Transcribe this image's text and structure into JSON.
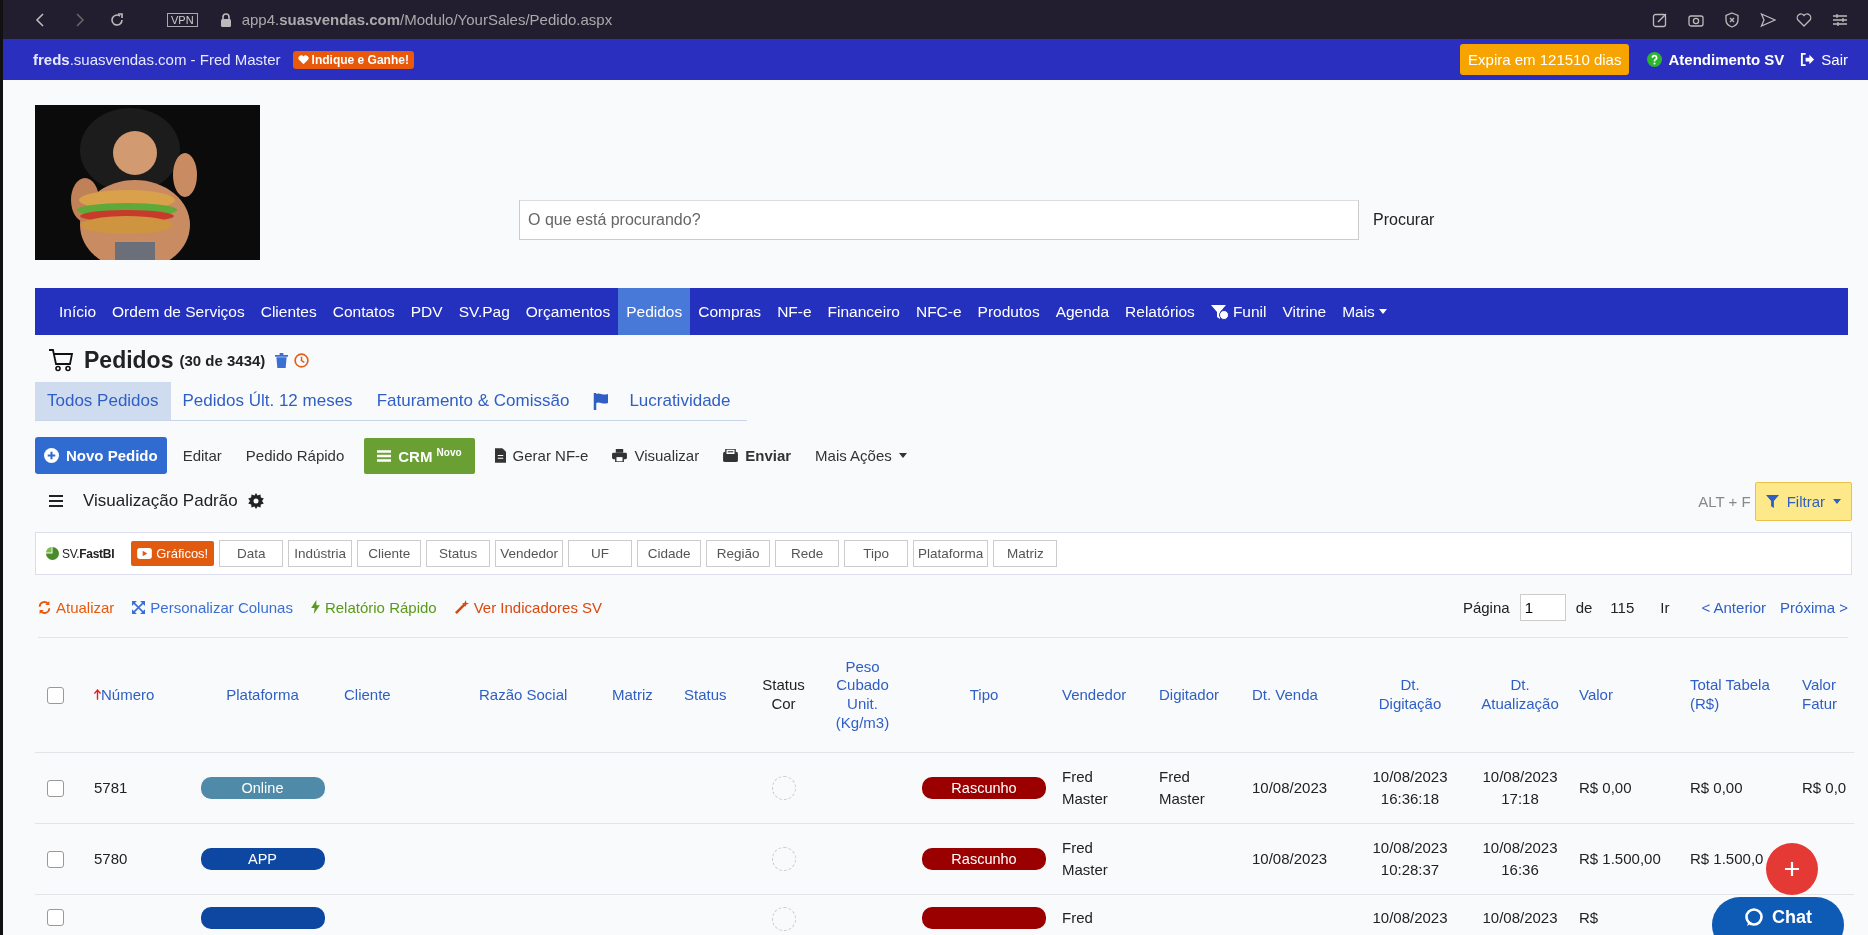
{
  "browser": {
    "vpn": "VPN",
    "url": "app4.**suasvendas.com**/Modulo/YourSales/Pedido.aspx"
  },
  "topbar": {
    "site": "**freds**.suasvendas.com - Fred Master",
    "referral": "Indique e Ganhe!",
    "expiry": "Expira em 121510 dias",
    "support": "Atendimento SV",
    "logout": "Sair"
  },
  "search": {
    "placeholder": "O que está procurando?",
    "button": "Procurar"
  },
  "nav": [
    {
      "label": "Início",
      "kind": "link",
      "selected": false
    },
    {
      "label": "Ordem de Serviços",
      "kind": "link",
      "selected": false
    },
    {
      "label": "Clientes",
      "kind": "link",
      "selected": false
    },
    {
      "label": "Contatos",
      "kind": "link",
      "selected": false
    },
    {
      "label": "PDV",
      "kind": "link",
      "selected": false
    },
    {
      "label": "SV.Pag",
      "kind": "link",
      "selected": false
    },
    {
      "label": "Orçamentos",
      "kind": "link",
      "selected": false
    },
    {
      "label": "Pedidos",
      "kind": "link",
      "selected": true
    },
    {
      "label": "Compras",
      "kind": "link",
      "selected": false
    },
    {
      "label": "NF-e",
      "kind": "link",
      "selected": false
    },
    {
      "label": "Financeiro",
      "kind": "link",
      "selected": false
    },
    {
      "label": "NFC-e",
      "kind": "link",
      "selected": false
    },
    {
      "label": "Produtos",
      "kind": "link",
      "selected": false
    },
    {
      "label": "Agenda",
      "kind": "link",
      "selected": false
    },
    {
      "label": "Relatórios",
      "kind": "link",
      "selected": false
    },
    {
      "label": "Funil",
      "kind": "funnel",
      "selected": false
    },
    {
      "label": "Vitrine",
      "kind": "link",
      "selected": false
    },
    {
      "label": "Mais",
      "kind": "dropdown",
      "selected": false
    }
  ],
  "page": {
    "title": "Pedidos",
    "count": "(30 de 3434)"
  },
  "tabs": [
    {
      "label": "Todos Pedidos",
      "kind": "plain",
      "selected": true
    },
    {
      "label": "Pedidos Últ. 12 meses",
      "kind": "plain",
      "selected": false
    },
    {
      "label": "Faturamento & Comissão",
      "kind": "plain",
      "selected": false
    },
    {
      "label": "Lucratividade",
      "kind": "flag",
      "selected": false
    }
  ],
  "toolbar": [
    {
      "label": "Novo Pedido",
      "kind": "primary"
    },
    {
      "label": "Editar",
      "kind": "plain"
    },
    {
      "label": "Pedido Rápido",
      "kind": "plain"
    },
    {
      "label": "CRM $^{Novo}$",
      "kind": "crm"
    },
    {
      "label": "Gerar NF-e",
      "kind": "document"
    },
    {
      "label": "Visualizar",
      "kind": "print"
    },
    {
      "label": "Enviar",
      "kind": "send"
    },
    {
      "label": "Mais Ações",
      "kind": "dropdown"
    }
  ],
  "view": {
    "label": "Visualização Padrão",
    "shortcut": "ALT + F",
    "filter": "Filtrar"
  },
  "chips": {
    "fastbi": "SV.**FastBI**",
    "charts": "Gráficos!",
    "groups": [
      "Data",
      "Indústria",
      "Cliente",
      "Status",
      "Vendedor",
      "UF",
      "Cidade",
      "Região",
      "Rede",
      "Tipo",
      "Plataforma",
      "Matriz"
    ]
  },
  "actions": [
    {
      "label": "Atualizar",
      "kind": "refresh",
      "color": "#e8590c"
    },
    {
      "label": "Personalizar Colunas",
      "kind": "expand",
      "color": "#3b6fd4"
    },
    {
      "label": "Relatório Rápido",
      "kind": "bolt",
      "color": "#5a9a1a"
    },
    {
      "label": "Ver Indicadores SV",
      "kind": "wand",
      "color": "#d9480f"
    }
  ],
  "pagination": {
    "label": "Página",
    "value": "1",
    "of": "de",
    "total": "115",
    "go": "Ir",
    "prev": "< Anterior",
    "next": "Próxima >"
  },
  "table": {
    "all_selected": false,
    "columns": [
      {
        "label": "Número",
        "sorted": true,
        "color": "#2f5fc4"
      },
      {
        "label": "Plataforma",
        "sorted": false,
        "color": "#2f5fc4"
      },
      {
        "label": "Cliente",
        "sorted": false,
        "color": "#2f5fc4"
      },
      {
        "label": "Razão Social",
        "sorted": false,
        "color": "#2f5fc4"
      },
      {
        "label": "Matriz",
        "sorted": false,
        "color": "#2f5fc4"
      },
      {
        "label": "Status",
        "sorted": false,
        "color": "#2f5fc4"
      },
      {
        "label": "Status\nCor",
        "sorted": false,
        "color": "#222222"
      },
      {
        "label": "Peso\nCubado\nUnit.\n(Kg/m3)",
        "sorted": false,
        "color": "#2f5fc4"
      },
      {
        "label": "Tipo",
        "sorted": false,
        "color": "#2f5fc4"
      },
      {
        "label": "Vendedor",
        "sorted": false,
        "color": "#2f5fc4"
      },
      {
        "label": "Digitador",
        "sorted": false,
        "color": "#2f5fc4"
      },
      {
        "label": "Dt. Venda",
        "sorted": false,
        "color": "#2f5fc4"
      },
      {
        "label": "Dt.\nDigitação",
        "sorted": false,
        "color": "#2f5fc4"
      },
      {
        "label": "Dt.\nAtualização",
        "sorted": false,
        "color": "#2f5fc4"
      },
      {
        "label": "Valor",
        "sorted": false,
        "color": "#2f5fc4"
      },
      {
        "label": "Total Tabela\n(R$)",
        "sorted": false,
        "color": "#2f5fc4"
      },
      {
        "label": "Valor\nFatur",
        "sorted": false,
        "color": "#2f5fc4"
      }
    ],
    "rows": [
      {
        "selected": false,
        "numero": "5781",
        "plataforma": {
          "label": "Online",
          "color": "#4f8aa8"
        },
        "tipo": {
          "label": "Rascunho",
          "color": "#9b0000"
        },
        "vendedor": "Fred\nMaster",
        "digitador": "Fred\nMaster",
        "dt_venda": "10/08/2023",
        "dt_digitacao": "10/08/2023\n16:36:18",
        "dt_atualizacao": "10/08/2023\n17:18",
        "valor": "R$ 0,00",
        "total_tabela": "R$ 0,00",
        "valor_faturado": "R$ 0,0"
      },
      {
        "selected": false,
        "numero": "5780",
        "plataforma": {
          "label": "APP",
          "color": "#0d47a1"
        },
        "tipo": {
          "label": "Rascunho",
          "color": "#9b0000"
        },
        "vendedor": "Fred\nMaster",
        "dt_venda": "10/08/2023",
        "dt_digitacao": "10/08/2023\n10:28:37",
        "dt_atualizacao": "10/08/2023\n16:36",
        "valor": "R$ 1.500,00",
        "total_tabela": "R$ 1.500,0"
      },
      {
        "selected": false,
        "plataforma": {
          "color": "#0d47a1"
        },
        "tipo": {
          "color": "#9b0000"
        },
        "vendedor": "Fred",
        "dt_digitacao": "10/08/2023",
        "dt_atualizacao": "10/08/2023",
        "valor": "R$"
      }
    ]
  },
  "chat": {
    "label": "Chat"
  }
}
